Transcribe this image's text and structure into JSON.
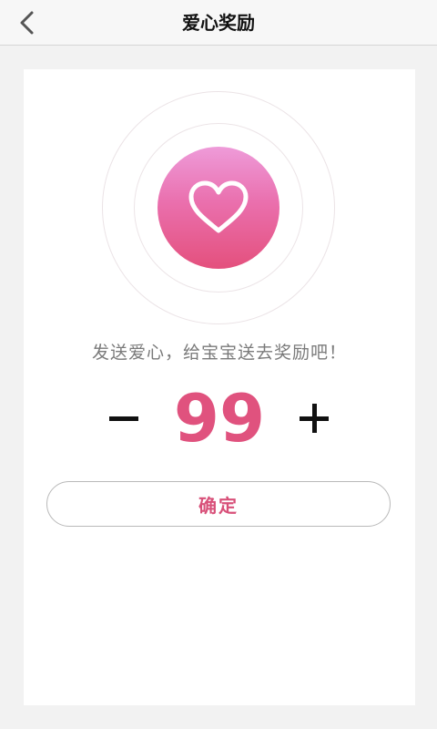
{
  "header": {
    "title": "爱心奖励"
  },
  "icons": {
    "back": "chevron-left-icon",
    "heart": "heart-outline-icon"
  },
  "main": {
    "prompt": "发送爱心，给宝宝送去奖励吧！",
    "counter": {
      "value": "99"
    },
    "confirm_label": "确定"
  },
  "colors": {
    "accent": "#e0527e",
    "heart_gradient_top": "#ee9bd9",
    "heart_gradient_bottom": "#e4507d",
    "background": "#f2f2f2",
    "card": "#ffffff"
  }
}
